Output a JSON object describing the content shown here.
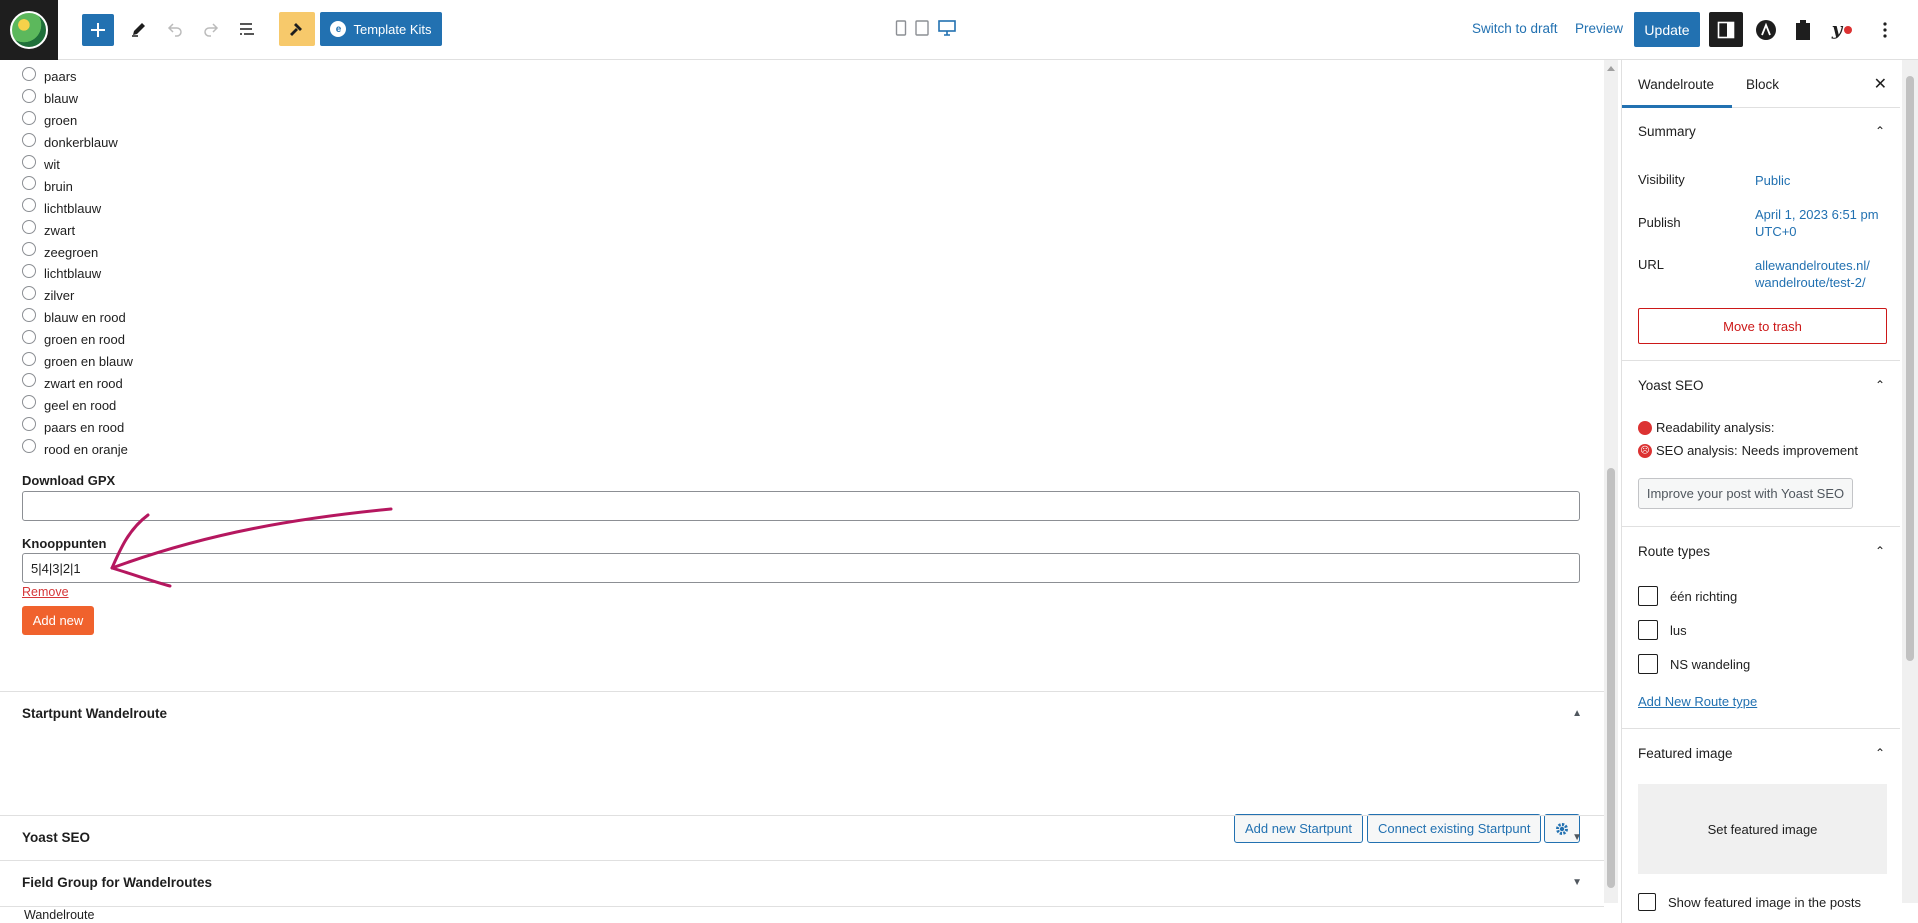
{
  "toolbar": {
    "template_kits_label": "Template Kits",
    "switch_to_draft": "Switch to draft",
    "preview": "Preview",
    "update": "Update"
  },
  "editor": {
    "color_options": [
      "paars",
      "blauw",
      "groen",
      "donkerblauw",
      "wit",
      "bruin",
      "lichtblauw",
      "zwart",
      "zeegroen",
      "lichtblauw",
      "zilver",
      "blauw en rood",
      "groen en rood",
      "groen en blauw",
      "zwart en rood",
      "geel en rood",
      "paars en rood",
      "rood en oranje"
    ],
    "download_gpx_label": "Download GPX",
    "download_gpx_value": "",
    "knooppunten_label": "Knooppunten",
    "knooppunten_value": "5|4|3|2|1",
    "remove_label": "Remove",
    "add_new_label": "Add new",
    "startpunt_title": "Startpunt Wandelroute",
    "add_new_startpunt": "Add new Startpunt",
    "connect_existing_startpunt": "Connect existing Startpunt",
    "yoast_section_title": "Yoast SEO",
    "field_group_title": "Field Group for Wandelroutes",
    "breadcrumb": "Wandelroute"
  },
  "sidebar": {
    "tab_post": "Wandelroute",
    "tab_block": "Block",
    "summary_title": "Summary",
    "visibility_label": "Visibility",
    "visibility_value": "Public",
    "publish_label": "Publish",
    "publish_value_line1": "April 1, 2023 6:51 pm",
    "publish_value_line2": "UTC+0",
    "url_label": "URL",
    "url_value_line1": "allewandelroutes.nl/",
    "url_value_line2": "wandelroute/test-2/",
    "move_to_trash": "Move to trash",
    "yoast_title": "Yoast SEO",
    "readability_label": "Readability analysis:",
    "seo_label": "SEO analysis:",
    "seo_value": "Needs improvement",
    "improve_button": "Improve your post with Yoast SEO",
    "route_types_title": "Route types",
    "route_types": [
      "één richting",
      "lus",
      "NS wandeling"
    ],
    "add_route_type": "Add New Route type",
    "featured_image_title": "Featured image",
    "set_featured_image": "Set featured image",
    "show_featured_label": "Show featured image in the posts"
  },
  "colors": {
    "accent": "#2271b1",
    "orange": "#f0622d",
    "danger": "#cc1818",
    "annotation_arrow": "#b5175f"
  }
}
